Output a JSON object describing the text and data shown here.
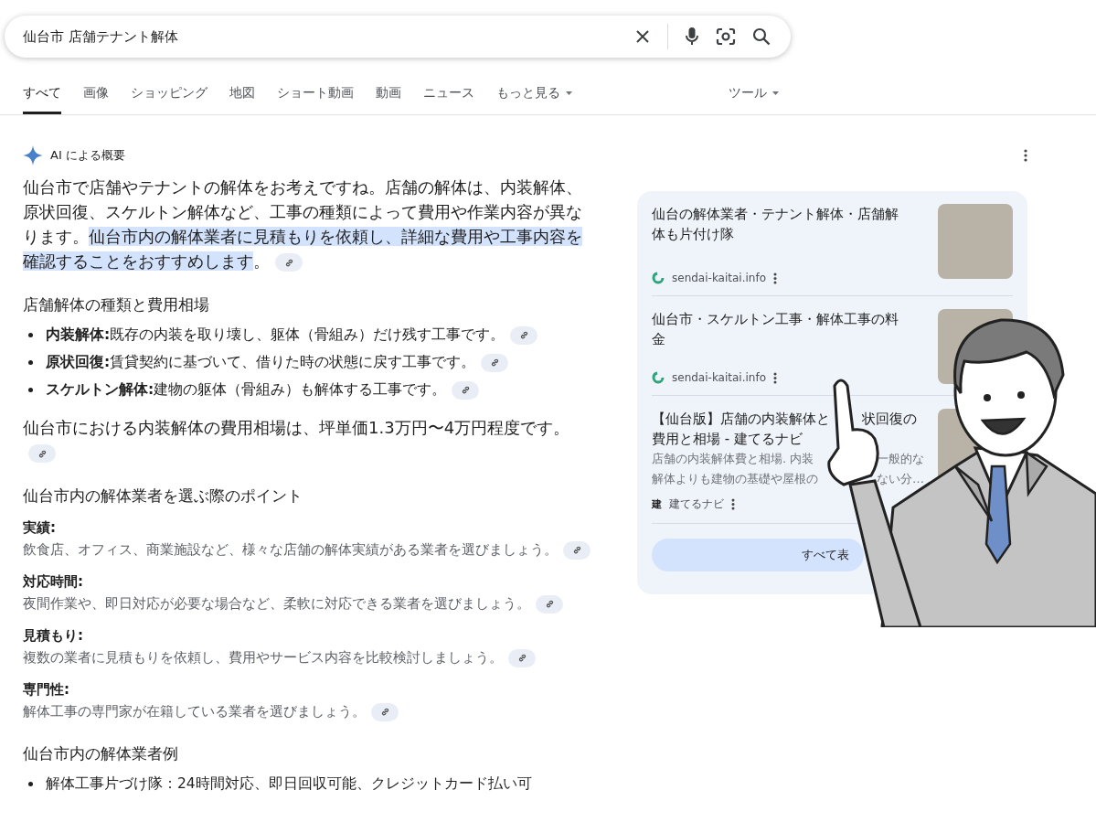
{
  "search": {
    "value": "仙台市 店舗テナント解体"
  },
  "tabs": [
    {
      "label": "すべて",
      "selected": true,
      "dropdown": false
    },
    {
      "label": "画像",
      "selected": false,
      "dropdown": false
    },
    {
      "label": "ショッピング",
      "selected": false,
      "dropdown": false
    },
    {
      "label": "地図",
      "selected": false,
      "dropdown": false
    },
    {
      "label": "ショート動画",
      "selected": false,
      "dropdown": false
    },
    {
      "label": "動画",
      "selected": false,
      "dropdown": false
    },
    {
      "label": "ニュース",
      "selected": false,
      "dropdown": false
    },
    {
      "label": "もっと見る",
      "selected": false,
      "dropdown": true
    }
  ],
  "tools": {
    "label": "ツール"
  },
  "ai_overview": {
    "title": "AI による概要",
    "blocks": [
      {
        "kind": "paragraph",
        "link": true,
        "parts": [
          {
            "text": "仙台市で店舗やテナントの解体をお考えですね。店舗の解体は、内装解体、原状回復、スケルトン解体など、工事の種類によって費用や作業内容が異なります。",
            "highlighted": false
          },
          {
            "text": "仙台市内の解体業者に見積もりを依頼し、詳細な費用や工事内容を確認することをおすすめします",
            "highlighted": true
          },
          {
            "text": "。",
            "highlighted": false
          }
        ]
      },
      {
        "kind": "heading",
        "text": "店舗解体の種類と費用相場"
      },
      {
        "kind": "bullets",
        "items": [
          {
            "text": "**内装解体:**既存の内装を取り壊し、躯体（骨組み）だけ残す工事です。",
            "link": true
          },
          {
            "text": "**原状回復:**賃貸契約に基づいて、借りた時の状態に戻す工事です。",
            "link": true
          },
          {
            "text": "**スケルトン解体:**建物の躯体（骨組み）も解体する工事です。",
            "link": true
          }
        ]
      },
      {
        "kind": "paragraph",
        "link": true,
        "parts": [
          {
            "text": "仙台市における内装解体の費用相場は、坪単価1.3万円〜4万円程度です。",
            "highlighted": false
          }
        ]
      },
      {
        "kind": "heading",
        "text": "仙台市内の解体業者を選ぶ際のポイント"
      },
      {
        "kind": "point",
        "label": "実績:",
        "text": "飲食店、オフィス、商業施設など、様々な店舗の解体実績がある業者を選びましょう。",
        "link": true
      },
      {
        "kind": "point",
        "label": "対応時間:",
        "text": "夜間作業や、即日対応が必要な場合など、柔軟に対応できる業者を選びましょう。",
        "link": true
      },
      {
        "kind": "point",
        "label": "見積もり:",
        "text": "複数の業者に見積もりを依頼し、費用やサービス内容を比較検討しましょう。",
        "link": true
      },
      {
        "kind": "point",
        "label": "専門性:",
        "text": "解体工事の専門家が在籍している業者を選びましょう。",
        "link": true
      },
      {
        "kind": "heading",
        "text": "仙台市内の解体業者例"
      },
      {
        "kind": "bullets",
        "items": [
          {
            "text": "解体工事片づけ隊：24時間対応、即日回収可能、クレジットカード払い可",
            "link": false
          }
        ]
      }
    ]
  },
  "sources": [
    {
      "title_lines": [
        [
          "仙台の解体業者・テナント解体・店舗解"
        ],
        [
          "体も片付け隊"
        ]
      ],
      "site": "sendai-kaitai.info"
    },
    {
      "title_lines": [
        [
          "仙台市・スケルトン工事・解体工事の料"
        ],
        [
          "金"
        ]
      ],
      "site": "sendai-kaitai.info"
    },
    {
      "title_lines": [
        [
          "【仙台版】店舗の内装解体と",
          "状回復の"
        ],
        [
          "費用と相場 - 建てるナビ"
        ]
      ],
      "snippet_lines": [
        [
          "店舗の内装解体費と相場. 内装",
          "一般的な"
        ],
        [
          "解体よりも建物の基礎や屋根の",
          "ない分…"
        ]
      ],
      "favicon_text": "建",
      "site": "建てるナビ"
    }
  ],
  "show_all": {
    "label": "すべて表"
  }
}
